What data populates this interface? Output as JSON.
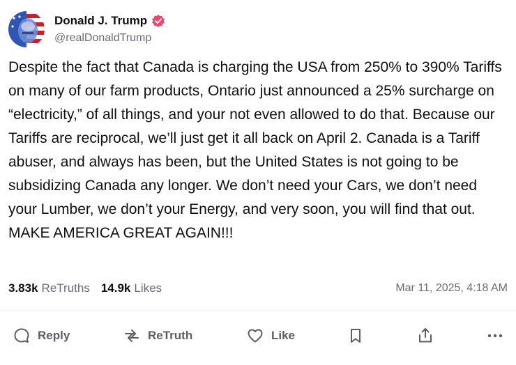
{
  "author": {
    "name": "Donald J. Trump",
    "handle": "@realDonaldTrump",
    "verified_color": "#f0466e"
  },
  "post": {
    "text": "Despite the fact that Canada is charging the USA from 250% to 390% Tariffs on many of our farm products, Ontario just announced a 25% surcharge on “electricity,” of all things, and your not even allowed to do that. Because our Tariffs are reciprocal, we’ll just get it all back on April 2. Canada is a Tariff abuser, and always has been, but the United States is not going to be subsidizing Canada any longer. We don’t need your Cars, we don’t need your Lumber, we don’t your Energy, and very soon, you will find that out. MAKE AMERICA GREAT AGAIN!!!",
    "retruths_count": "3.83k",
    "retruths_label": "ReTruths",
    "likes_count": "14.9k",
    "likes_label": "Likes",
    "timestamp": "Mar 11, 2025, 4:18 AM"
  },
  "actions": {
    "reply_label": "Reply",
    "retruth_label": "ReTruth",
    "like_label": "Like"
  },
  "icons": [
    "avatar-image",
    "verified-badge-icon",
    "reply-icon",
    "retruth-icon",
    "like-icon",
    "bookmark-icon",
    "share-icon",
    "more-icon"
  ]
}
